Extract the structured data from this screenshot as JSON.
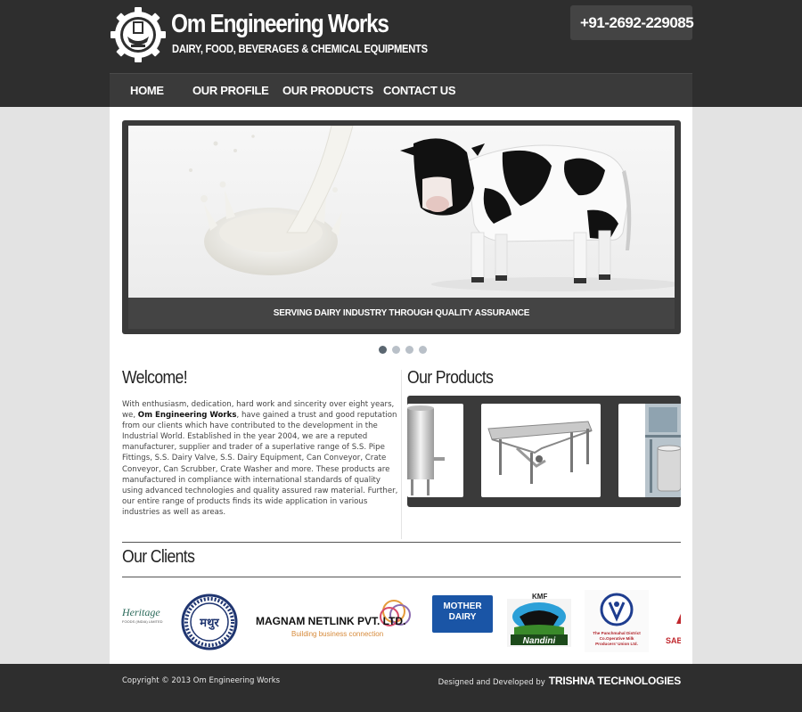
{
  "header": {
    "logo_title": "Om Engineering Works",
    "logo_subtitle": "DAIRY, FOOD, BEVERAGES & CHEMICAL EQUIPMENTS",
    "phone": "+91-2692-229085"
  },
  "nav": {
    "items": [
      {
        "label": "HOME"
      },
      {
        "label": "OUR PROFILE"
      },
      {
        "label": "OUR PRODUCTS"
      },
      {
        "label": "CONTACT US"
      }
    ]
  },
  "slider": {
    "caption": "SERVING DAIRY INDUSTRY THROUGH QUALITY ASSURANCE",
    "slide_count": 4,
    "active_slide": 1
  },
  "welcome": {
    "heading": "Welcome!",
    "text_before": "With enthusiasm, dedication, hard work and sincerity over eight years, we, ",
    "company": "Om Engineering Works",
    "text_after": ", have gained a trust and good reputation from our clients which have contributed to the development in the Industrial World. Established in the year 2004, we are a reputed manufacturer, supplier and trader of a superlative range of S.S. Pipe Fittings, S.S. Dairy Valve, S.S. Dairy Equipment, Can Conveyor, Crate Conveyor, Can Scrubber, Crate Washer and more. These products are manufactured in compliance with international standards of quality using advanced technologies and quality assured raw material. Further, our entire range of products finds its wide application in various industries as well as areas."
  },
  "products": {
    "heading": "Our Products"
  },
  "clients": {
    "heading": "Our Clients",
    "logos": {
      "heritage": "Heritage",
      "heritage_sub": "FOODS (INDIA) LIMITED",
      "mathur": "मथुर",
      "magnam": "MAGNAM NETLINK PVT. LTD.",
      "magnam_tag": "Building business connection",
      "mother_dairy_1": "MOTHER",
      "mother_dairy_2": "DAIRY",
      "kmf": "KMF",
      "nandini": "Nandini",
      "panchmahal_1": "The Panchmahal District",
      "panchmahal_2": "Co.Operative Milk",
      "panchmahal_3": "Producers' Union Ltd.",
      "sab": "SAB"
    }
  },
  "footer": {
    "copyright": "Copyright © 2013 Om Engineering Works",
    "designed_by": "Designed and Developed by",
    "designer": "TRISHNA TECHNOLOGIES"
  },
  "colors": {
    "dark_band": "#2e2e2e",
    "nav_bg": "#3a3a3a",
    "page_bg": "#e3e3e3"
  }
}
